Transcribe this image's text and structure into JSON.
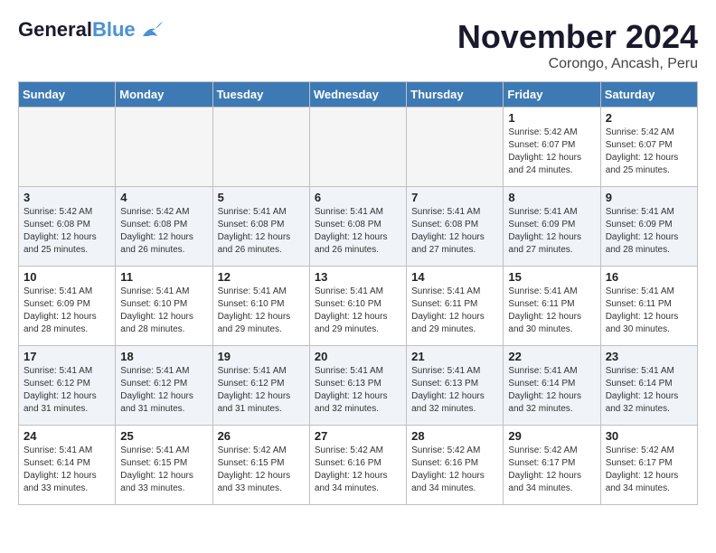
{
  "header": {
    "logo_general": "General",
    "logo_blue": "Blue",
    "month_title": "November 2024",
    "location": "Corongo, Ancash, Peru"
  },
  "days_of_week": [
    "Sunday",
    "Monday",
    "Tuesday",
    "Wednesday",
    "Thursday",
    "Friday",
    "Saturday"
  ],
  "weeks": [
    [
      {
        "day": "",
        "info": ""
      },
      {
        "day": "",
        "info": ""
      },
      {
        "day": "",
        "info": ""
      },
      {
        "day": "",
        "info": ""
      },
      {
        "day": "",
        "info": ""
      },
      {
        "day": "1",
        "info": "Sunrise: 5:42 AM\nSunset: 6:07 PM\nDaylight: 12 hours and 24 minutes."
      },
      {
        "day": "2",
        "info": "Sunrise: 5:42 AM\nSunset: 6:07 PM\nDaylight: 12 hours and 25 minutes."
      }
    ],
    [
      {
        "day": "3",
        "info": "Sunrise: 5:42 AM\nSunset: 6:08 PM\nDaylight: 12 hours and 25 minutes."
      },
      {
        "day": "4",
        "info": "Sunrise: 5:42 AM\nSunset: 6:08 PM\nDaylight: 12 hours and 26 minutes."
      },
      {
        "day": "5",
        "info": "Sunrise: 5:41 AM\nSunset: 6:08 PM\nDaylight: 12 hours and 26 minutes."
      },
      {
        "day": "6",
        "info": "Sunrise: 5:41 AM\nSunset: 6:08 PM\nDaylight: 12 hours and 26 minutes."
      },
      {
        "day": "7",
        "info": "Sunrise: 5:41 AM\nSunset: 6:08 PM\nDaylight: 12 hours and 27 minutes."
      },
      {
        "day": "8",
        "info": "Sunrise: 5:41 AM\nSunset: 6:09 PM\nDaylight: 12 hours and 27 minutes."
      },
      {
        "day": "9",
        "info": "Sunrise: 5:41 AM\nSunset: 6:09 PM\nDaylight: 12 hours and 28 minutes."
      }
    ],
    [
      {
        "day": "10",
        "info": "Sunrise: 5:41 AM\nSunset: 6:09 PM\nDaylight: 12 hours and 28 minutes."
      },
      {
        "day": "11",
        "info": "Sunrise: 5:41 AM\nSunset: 6:10 PM\nDaylight: 12 hours and 28 minutes."
      },
      {
        "day": "12",
        "info": "Sunrise: 5:41 AM\nSunset: 6:10 PM\nDaylight: 12 hours and 29 minutes."
      },
      {
        "day": "13",
        "info": "Sunrise: 5:41 AM\nSunset: 6:10 PM\nDaylight: 12 hours and 29 minutes."
      },
      {
        "day": "14",
        "info": "Sunrise: 5:41 AM\nSunset: 6:11 PM\nDaylight: 12 hours and 29 minutes."
      },
      {
        "day": "15",
        "info": "Sunrise: 5:41 AM\nSunset: 6:11 PM\nDaylight: 12 hours and 30 minutes."
      },
      {
        "day": "16",
        "info": "Sunrise: 5:41 AM\nSunset: 6:11 PM\nDaylight: 12 hours and 30 minutes."
      }
    ],
    [
      {
        "day": "17",
        "info": "Sunrise: 5:41 AM\nSunset: 6:12 PM\nDaylight: 12 hours and 31 minutes."
      },
      {
        "day": "18",
        "info": "Sunrise: 5:41 AM\nSunset: 6:12 PM\nDaylight: 12 hours and 31 minutes."
      },
      {
        "day": "19",
        "info": "Sunrise: 5:41 AM\nSunset: 6:12 PM\nDaylight: 12 hours and 31 minutes."
      },
      {
        "day": "20",
        "info": "Sunrise: 5:41 AM\nSunset: 6:13 PM\nDaylight: 12 hours and 32 minutes."
      },
      {
        "day": "21",
        "info": "Sunrise: 5:41 AM\nSunset: 6:13 PM\nDaylight: 12 hours and 32 minutes."
      },
      {
        "day": "22",
        "info": "Sunrise: 5:41 AM\nSunset: 6:14 PM\nDaylight: 12 hours and 32 minutes."
      },
      {
        "day": "23",
        "info": "Sunrise: 5:41 AM\nSunset: 6:14 PM\nDaylight: 12 hours and 32 minutes."
      }
    ],
    [
      {
        "day": "24",
        "info": "Sunrise: 5:41 AM\nSunset: 6:14 PM\nDaylight: 12 hours and 33 minutes."
      },
      {
        "day": "25",
        "info": "Sunrise: 5:41 AM\nSunset: 6:15 PM\nDaylight: 12 hours and 33 minutes."
      },
      {
        "day": "26",
        "info": "Sunrise: 5:42 AM\nSunset: 6:15 PM\nDaylight: 12 hours and 33 minutes."
      },
      {
        "day": "27",
        "info": "Sunrise: 5:42 AM\nSunset: 6:16 PM\nDaylight: 12 hours and 34 minutes."
      },
      {
        "day": "28",
        "info": "Sunrise: 5:42 AM\nSunset: 6:16 PM\nDaylight: 12 hours and 34 minutes."
      },
      {
        "day": "29",
        "info": "Sunrise: 5:42 AM\nSunset: 6:17 PM\nDaylight: 12 hours and 34 minutes."
      },
      {
        "day": "30",
        "info": "Sunrise: 5:42 AM\nSunset: 6:17 PM\nDaylight: 12 hours and 34 minutes."
      }
    ]
  ]
}
